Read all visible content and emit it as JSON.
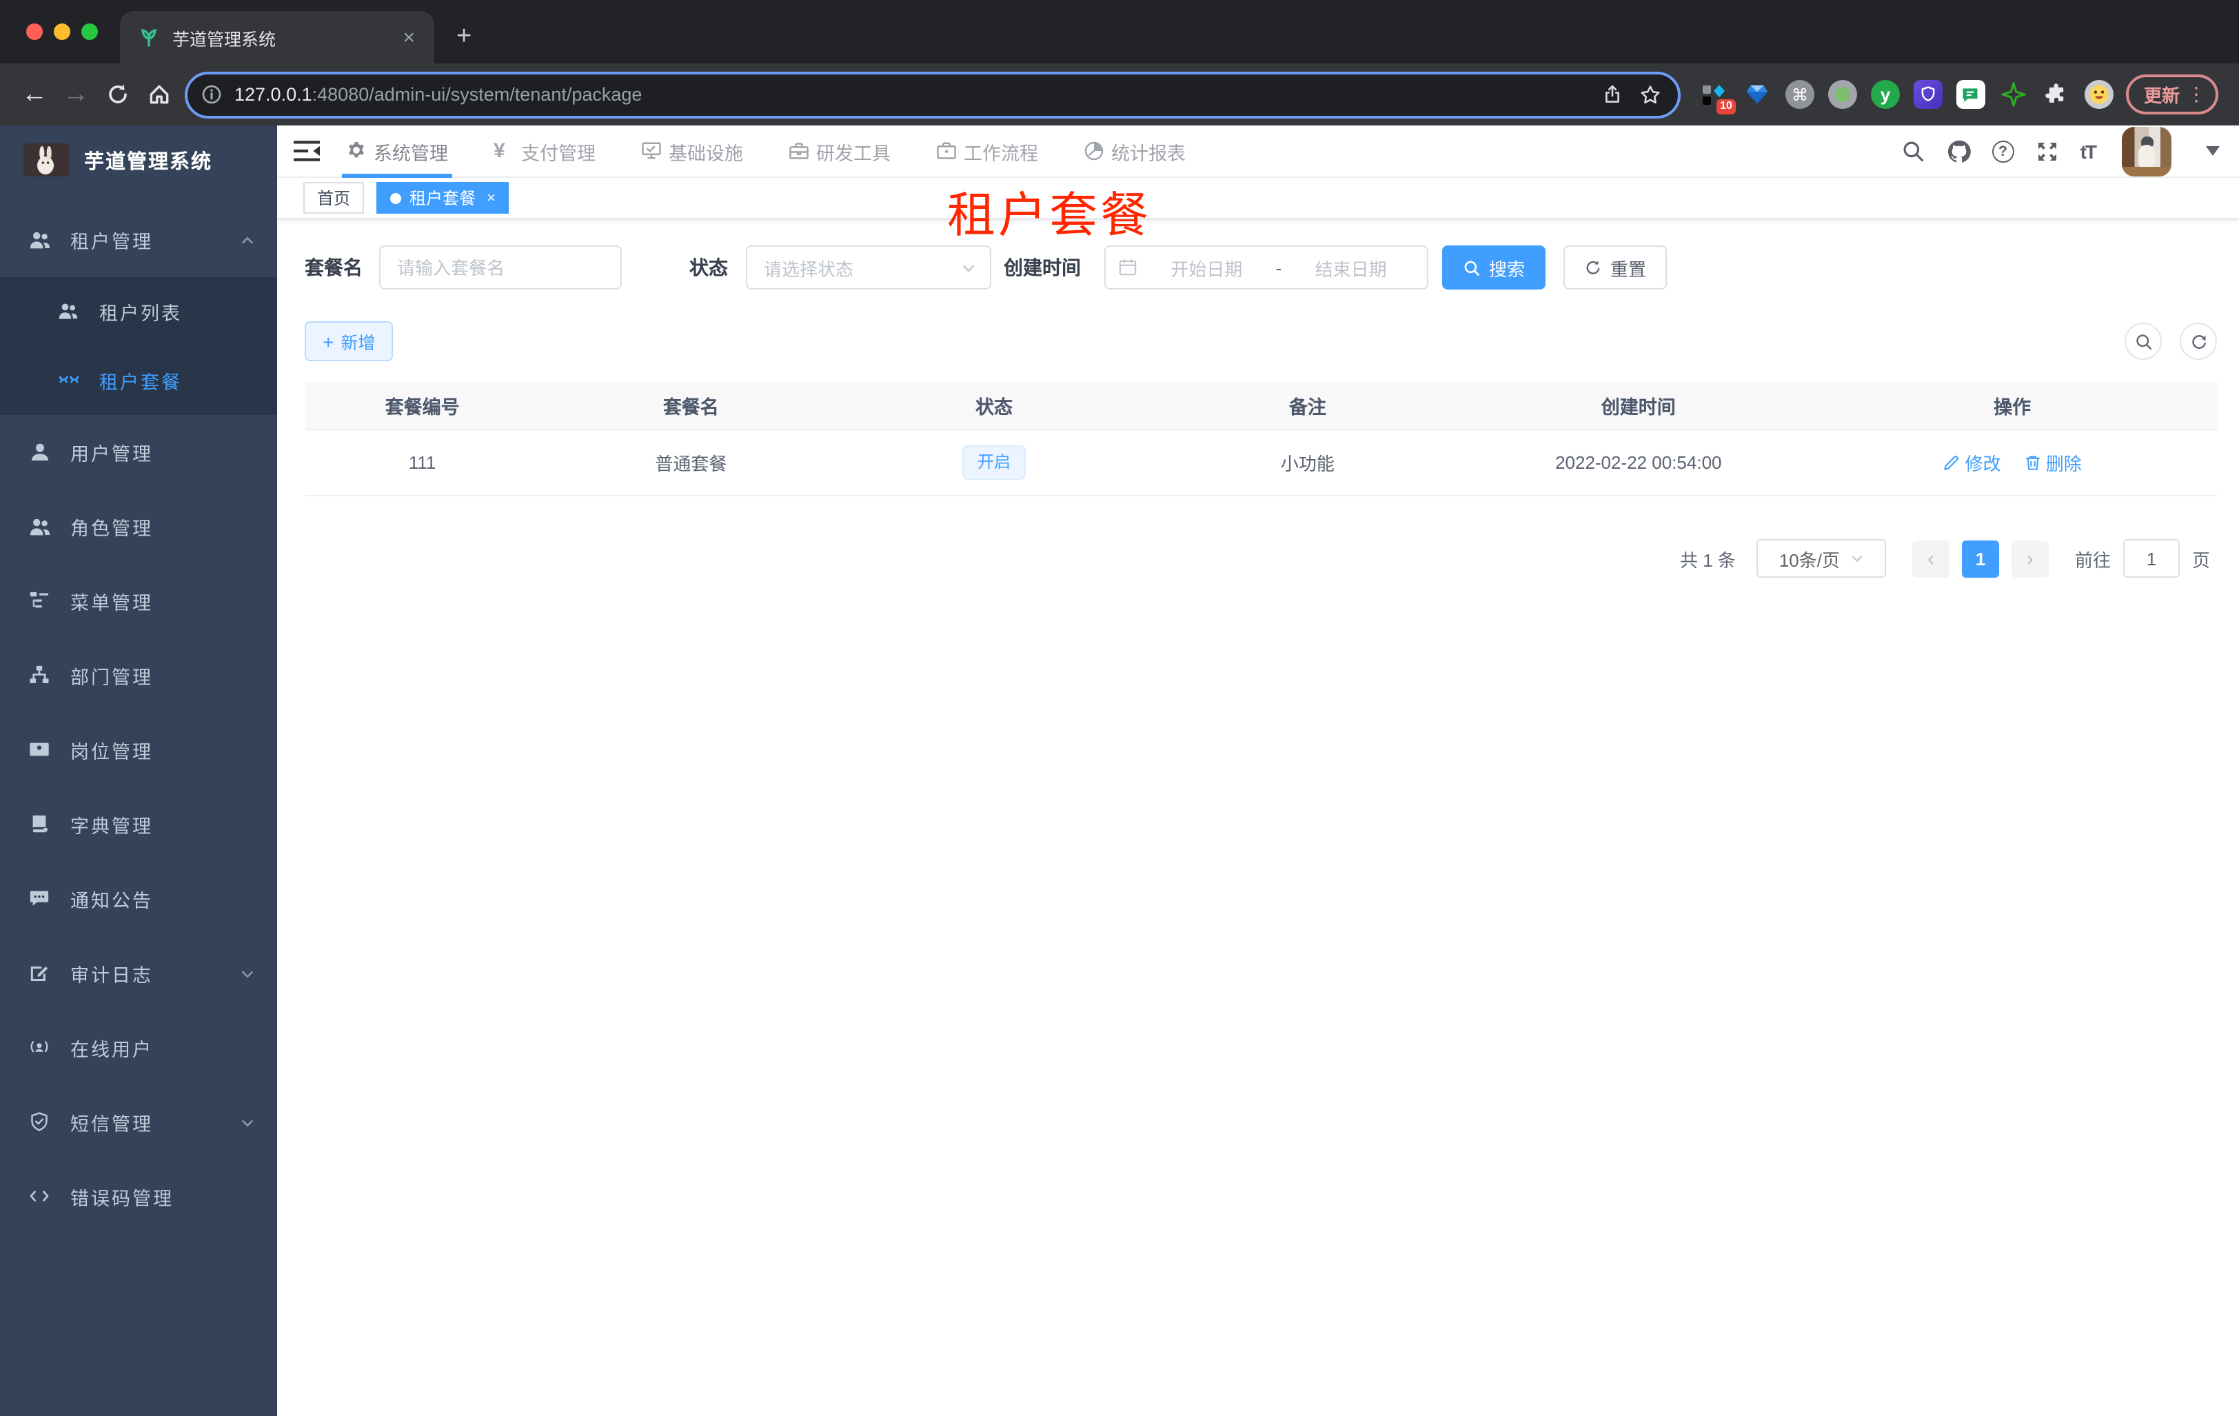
{
  "browser": {
    "tab_title": "芋道管理系统",
    "url_host": "127.0.0.1",
    "url_rest": ":48080/admin-ui/system/tenant/package",
    "extension_badge": "10",
    "update_label": "更新"
  },
  "icons": {
    "back": "←",
    "forward": "→",
    "new_tab": "+",
    "tab_close": "×",
    "kebab": "⋮",
    "cmd": "⌘",
    "ext_y": "y",
    "help": "?",
    "font_size": "tT",
    "plus": "+",
    "prev": "‹",
    "next": "›",
    "tag_close": "×"
  },
  "sidebar": {
    "brand": "芋道管理系统",
    "items": [
      {
        "label": "租户管理"
      },
      {
        "label": "租户列表"
      },
      {
        "label": "租户套餐"
      },
      {
        "label": "用户管理"
      },
      {
        "label": "角色管理"
      },
      {
        "label": "菜单管理"
      },
      {
        "label": "部门管理"
      },
      {
        "label": "岗位管理"
      },
      {
        "label": "字典管理"
      },
      {
        "label": "通知公告"
      },
      {
        "label": "审计日志"
      },
      {
        "label": "在线用户"
      },
      {
        "label": "短信管理"
      },
      {
        "label": "错误码管理"
      }
    ]
  },
  "nav": {
    "items": [
      "系统管理",
      "支付管理",
      "基础设施",
      "研发工具",
      "工作流程",
      "统计报表"
    ]
  },
  "tags": {
    "home": "首页",
    "active": "租户套餐"
  },
  "annotation": "租户套餐",
  "filters": {
    "name_label": "套餐名",
    "name_placeholder": "请输入套餐名",
    "status_label": "状态",
    "status_placeholder": "请选择状态",
    "date_label": "创建时间",
    "date_start": "开始日期",
    "date_separator": "-",
    "date_end": "结束日期",
    "search": "搜索",
    "reset": "重置"
  },
  "toolbar": {
    "add": "新增"
  },
  "table": {
    "headers": [
      "套餐编号",
      "套餐名",
      "状态",
      "备注",
      "创建时间",
      "操作"
    ],
    "rows": [
      {
        "id": "111",
        "name": "普通套餐",
        "status": "开启",
        "remark": "小功能",
        "created": "2022-02-22 00:54:00",
        "edit": "修改",
        "delete": "删除"
      }
    ]
  },
  "pagination": {
    "total": "共 1 条",
    "page_size": "10条/页",
    "current": "1",
    "goto": "前往",
    "goto_value": "1",
    "page_unit": "页"
  },
  "colors": {
    "accent": "#409eff",
    "sidebar_bg": "#344359",
    "submenu_bg": "#293649",
    "annotation_red": "#ff2600",
    "tag_active_bg": "#409eff",
    "status_tag_bg": "#ecf5ff"
  }
}
